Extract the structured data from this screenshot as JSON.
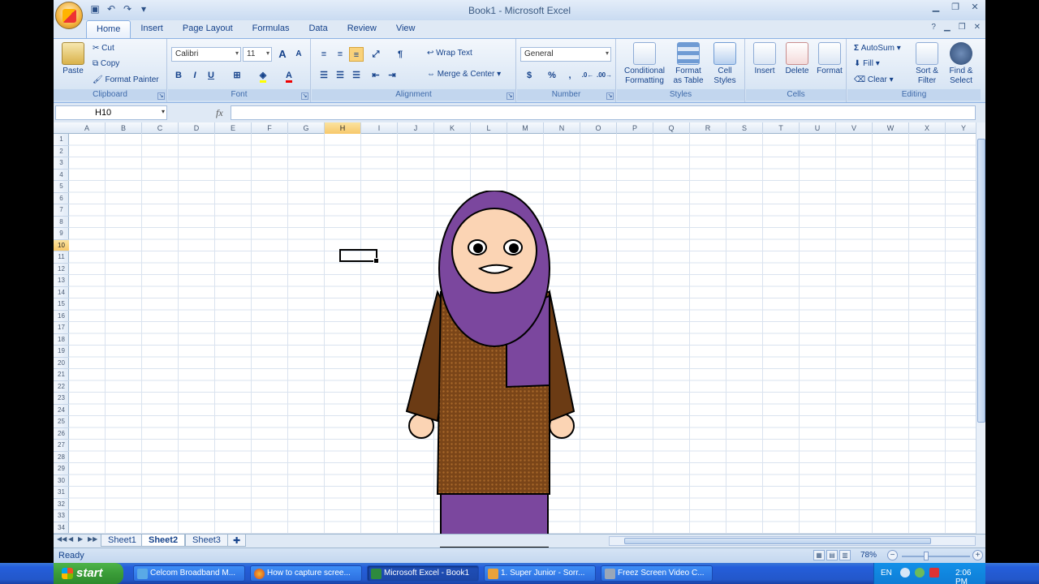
{
  "window": {
    "title": "Book1 - Microsoft Excel"
  },
  "ribbon_tabs": [
    "Home",
    "Insert",
    "Page Layout",
    "Formulas",
    "Data",
    "Review",
    "View"
  ],
  "clipboard": {
    "paste": "Paste",
    "cut": "Cut",
    "copy": "Copy",
    "format_painter": "Format Painter",
    "label": "Clipboard"
  },
  "font": {
    "name": "Calibri",
    "size": "11",
    "grow": "A",
    "shrink": "A",
    "bold": "B",
    "italic": "I",
    "underline": "U",
    "color_letter": "A",
    "label": "Font"
  },
  "alignment": {
    "wrap": "Wrap Text",
    "merge": "Merge & Center",
    "label": "Alignment"
  },
  "number": {
    "format": "General",
    "currency": "$",
    "percent": "%",
    "comma": ",",
    "label": "Number"
  },
  "styles": {
    "conditional_1": "Conditional",
    "conditional_2": "Formatting",
    "format_table_1": "Format",
    "format_table_2": "as Table",
    "cell_styles_1": "Cell",
    "cell_styles_2": "Styles",
    "label": "Styles"
  },
  "cells": {
    "insert": "Insert",
    "delete": "Delete",
    "format": "Format",
    "label": "Cells"
  },
  "editing": {
    "autosum": "AutoSum",
    "fill": "Fill",
    "clear": "Clear",
    "sort_1": "Sort &",
    "sort_2": "Filter",
    "find_1": "Find &",
    "find_2": "Select",
    "label": "Editing"
  },
  "formula_bar": {
    "name_box": "H10",
    "fx": "fx",
    "value": ""
  },
  "columns": [
    "A",
    "B",
    "C",
    "D",
    "E",
    "F",
    "G",
    "H",
    "I",
    "J",
    "K",
    "L",
    "M",
    "N",
    "O",
    "P",
    "Q",
    "R",
    "S",
    "T",
    "U",
    "V",
    "W",
    "X",
    "Y"
  ],
  "rows": [
    "1",
    "2",
    "3",
    "4",
    "5",
    "6",
    "7",
    "8",
    "9",
    "10",
    "11",
    "12",
    "13",
    "14",
    "15",
    "16",
    "17",
    "18",
    "19",
    "20",
    "21",
    "22",
    "23",
    "24",
    "25",
    "26",
    "27",
    "28",
    "29",
    "30",
    "31",
    "32",
    "33",
    "34"
  ],
  "selected": {
    "column": "H",
    "row": "10"
  },
  "sheets": [
    "Sheet1",
    "Sheet2",
    "Sheet3"
  ],
  "active_sheet": "Sheet2",
  "status": {
    "text": "Ready",
    "zoom": "78%"
  },
  "taskbar": {
    "start": "start",
    "tasks": [
      "Celcom Broadband M...",
      "How to capture scree...",
      "Microsoft Excel - Book1",
      "1. Super Junior - Sorr...",
      "Freez Screen Video C..."
    ],
    "active_task": "Microsoft Excel - Book1",
    "lang": "EN",
    "clock": "2:06 PM"
  },
  "colors": {
    "hijab": "#7b479e",
    "dress": "#6b3b14",
    "skin": "#fbd4b4",
    "accent": "#15428b"
  }
}
